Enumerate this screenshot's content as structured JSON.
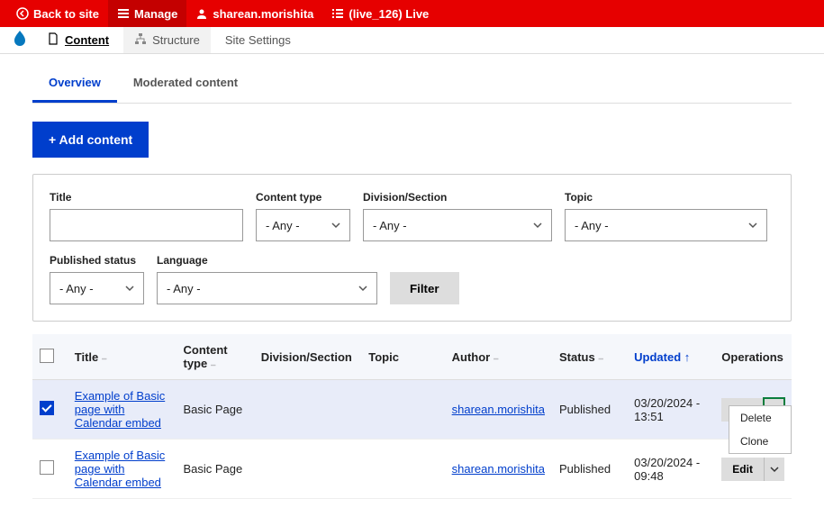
{
  "topbar": {
    "back": "Back to site",
    "manage": "Manage",
    "user": "sharean.morishita",
    "env": "(live_126) Live"
  },
  "adminbar": {
    "content": "Content",
    "structure": "Structure",
    "settings": "Site Settings"
  },
  "tabs": {
    "overview": "Overview",
    "moderated": "Moderated content"
  },
  "buttons": {
    "add": "+ Add content",
    "filter": "Filter"
  },
  "filters": {
    "title_label": "Title",
    "ct_label": "Content type",
    "ct_value": "- Any -",
    "ds_label": "Division/Section",
    "ds_value": "- Any -",
    "topic_label": "Topic",
    "topic_value": "- Any -",
    "pub_label": "Published status",
    "pub_value": "- Any -",
    "lang_label": "Language",
    "lang_value": "- Any -"
  },
  "columns": {
    "title": "Title",
    "ct": "Content type",
    "ds": "Division/Section",
    "topic": "Topic",
    "author": "Author",
    "status": "Status",
    "updated": "Updated",
    "ops": "Operations"
  },
  "ops": {
    "edit": "Edit",
    "delete": "Delete",
    "clone": "Clone"
  },
  "rows": [
    {
      "checked": true,
      "title": "Example of Basic page with Calendar embed",
      "ct": "Basic Page",
      "author": "sharean.morishita",
      "status": "Published",
      "updated": "03/20/2024 - 13:51",
      "menu_open": true
    },
    {
      "checked": false,
      "title": "Example of Basic page with Calendar embed",
      "ct": "Basic Page",
      "author": "sharean.morishita",
      "status": "Published",
      "updated": "03/20/2024 - 09:48",
      "menu_open": false
    }
  ]
}
